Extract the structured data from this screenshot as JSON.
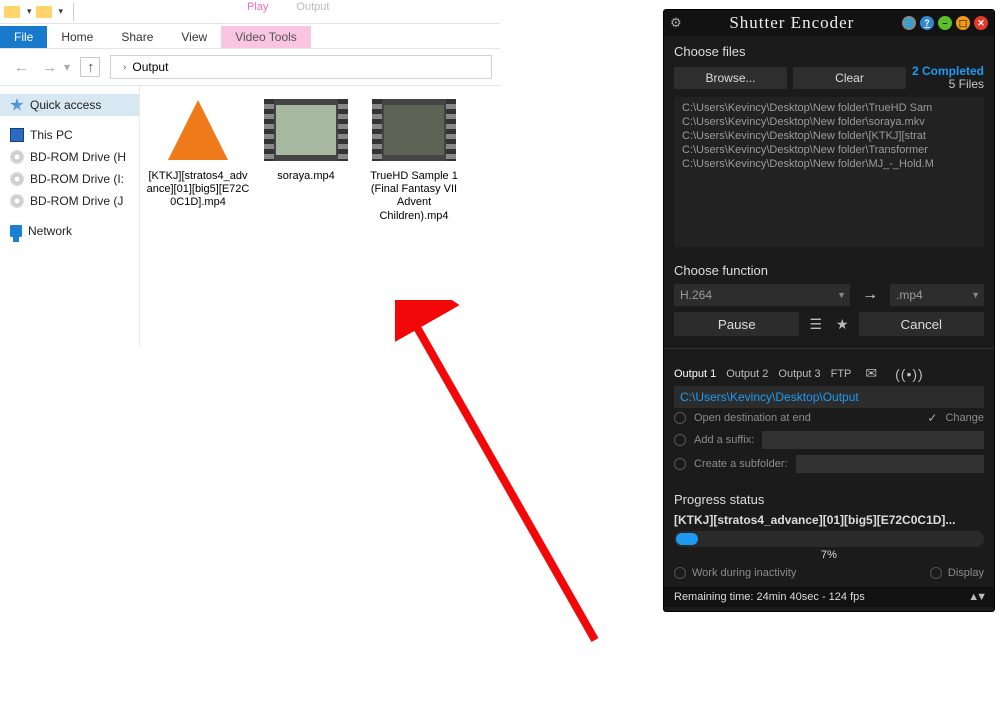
{
  "explorer": {
    "tabs": {
      "file": "File",
      "home": "Home",
      "share": "Share",
      "view": "View",
      "video_tools": "Video Tools",
      "play": "Play",
      "output": "Output"
    },
    "address": {
      "folder": "Output"
    },
    "sidebar": {
      "quick": "Quick access",
      "pc": "This PC",
      "bd1": "BD-ROM Drive (H",
      "bd2": "BD-ROM Drive (I:",
      "bd3": "BD-ROM Drive (J",
      "net": "Network"
    },
    "files": [
      {
        "name": "[KTKJ][stratos4_advance][01][big5][E72C0C1D].mp4"
      },
      {
        "name": "soraya.mp4"
      },
      {
        "name": "TrueHD Sample 1 (Final Fantasy VII Advent Children).mp4"
      }
    ]
  },
  "shutter": {
    "title": "Shutter Encoder",
    "choose_files_hdr": "Choose files",
    "browse": "Browse...",
    "clear": "Clear",
    "completed": "2 Completed",
    "files_count": "5 Files",
    "file_items": [
      "C:\\Users\\Kevincy\\Desktop\\New folder\\TrueHD Sam",
      "C:\\Users\\Kevincy\\Desktop\\New folder\\soraya.mkv",
      "C:\\Users\\Kevincy\\Desktop\\New folder\\[KTKJ][strat",
      "C:\\Users\\Kevincy\\Desktop\\New folder\\Transformer",
      "C:\\Users\\Kevincy\\Desktop\\New folder\\MJ_-_Hold.M"
    ],
    "choose_func_hdr": "Choose function",
    "codec": "H.264",
    "container": ".mp4",
    "pause": "Pause",
    "cancel": "Cancel",
    "outtabs": [
      "Output 1",
      "Output 2",
      "Output 3",
      "FTP"
    ],
    "outpath": "C:\\Users\\Kevincy\\Desktop\\Output",
    "open_dest": "Open destination at end",
    "change": "Change",
    "suffix": "Add a suffix:",
    "subfolder": "Create a subfolder:",
    "progress_hdr": "Progress status",
    "current": "[KTKJ][stratos4_advance][01][big5][E72C0C1D]...",
    "pct": "7%",
    "work": "Work during inactivity",
    "display": "Display",
    "remaining": "Remaining time: 24min 40sec - 124 fps"
  }
}
